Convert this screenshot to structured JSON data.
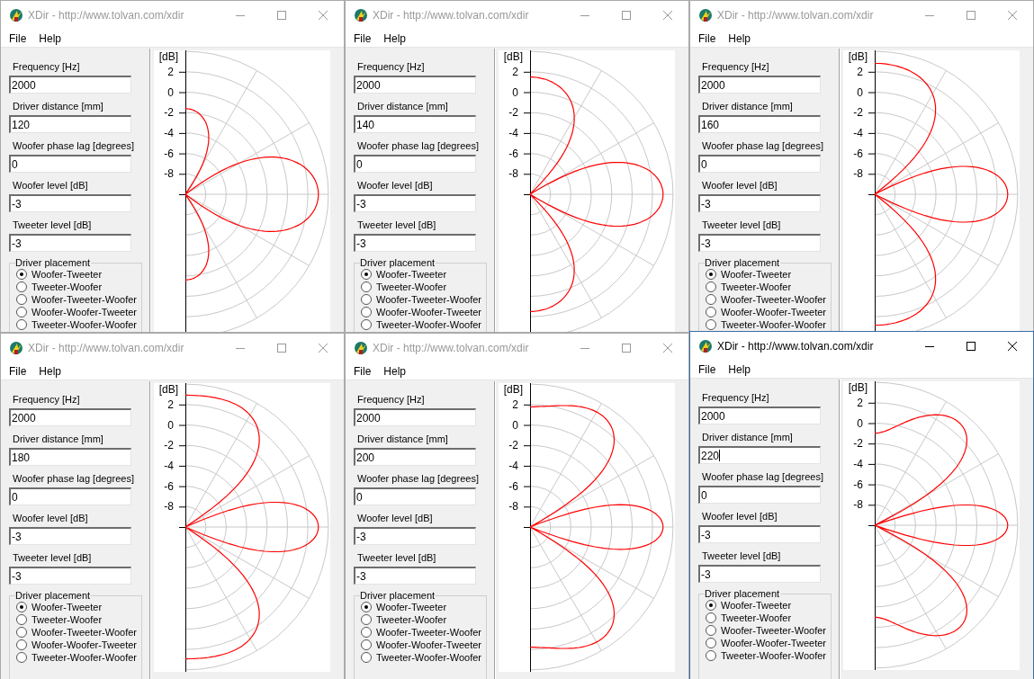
{
  "windows": [
    {
      "title": "XDir - http://www.tolvan.com/xdir",
      "active": false,
      "menu": [
        "File",
        "Help"
      ],
      "fields": [
        {
          "label": "Frequency [Hz]",
          "value": "2000",
          "focused": false
        },
        {
          "label": "Driver distance [mm]",
          "value": "120",
          "focused": false
        },
        {
          "label": "Woofer phase lag [degrees]",
          "value": "0",
          "focused": false
        },
        {
          "label": "Woofer level [dB]",
          "value": "-3",
          "focused": false
        },
        {
          "label": "Tweeter level [dB]",
          "value": "-3",
          "focused": false
        }
      ],
      "placement": {
        "title": "Driver placement",
        "options": [
          {
            "label": "Woofer-Tweeter",
            "selected": true
          },
          {
            "label": "Tweeter-Woofer",
            "selected": false
          },
          {
            "label": "Woofer-Tweeter-Woofer",
            "selected": false
          },
          {
            "label": "Woofer-Woofer-Tweeter",
            "selected": false
          },
          {
            "label": "Tweeter-Woofer-Woofer",
            "selected": false
          }
        ]
      },
      "plot": {
        "unit": "[dB]",
        "ticks": [
          "2",
          "0",
          "-2",
          "-4",
          "-6",
          "-8"
        ]
      }
    },
    {
      "title": "XDir - http://www.tolvan.com/xdir",
      "active": false,
      "menu": [
        "File",
        "Help"
      ],
      "fields": [
        {
          "label": "Frequency [Hz]",
          "value": "2000",
          "focused": false
        },
        {
          "label": "Driver distance [mm]",
          "value": "140",
          "focused": false
        },
        {
          "label": "Woofer phase lag [degrees]",
          "value": "0",
          "focused": false
        },
        {
          "label": "Woofer level [dB]",
          "value": "-3",
          "focused": false
        },
        {
          "label": "Tweeter level [dB]",
          "value": "-3",
          "focused": false
        }
      ],
      "placement": {
        "title": "Driver placement",
        "options": [
          {
            "label": "Woofer-Tweeter",
            "selected": true
          },
          {
            "label": "Tweeter-Woofer",
            "selected": false
          },
          {
            "label": "Woofer-Tweeter-Woofer",
            "selected": false
          },
          {
            "label": "Woofer-Woofer-Tweeter",
            "selected": false
          },
          {
            "label": "Tweeter-Woofer-Woofer",
            "selected": false
          }
        ]
      },
      "plot": {
        "unit": "[dB]",
        "ticks": [
          "2",
          "0",
          "-2",
          "-4",
          "-6",
          "-8"
        ]
      }
    },
    {
      "title": "XDir - http://www.tolvan.com/xdir",
      "active": false,
      "menu": [
        "File",
        "Help"
      ],
      "fields": [
        {
          "label": "Frequency [Hz]",
          "value": "2000",
          "focused": false
        },
        {
          "label": "Driver distance [mm]",
          "value": "160",
          "focused": false
        },
        {
          "label": "Woofer phase lag [degrees]",
          "value": "0",
          "focused": false
        },
        {
          "label": "Woofer level [dB]",
          "value": "-3",
          "focused": false
        },
        {
          "label": "Tweeter level [dB]",
          "value": "-3",
          "focused": false
        }
      ],
      "placement": {
        "title": "Driver placement",
        "options": [
          {
            "label": "Woofer-Tweeter",
            "selected": true
          },
          {
            "label": "Tweeter-Woofer",
            "selected": false
          },
          {
            "label": "Woofer-Tweeter-Woofer",
            "selected": false
          },
          {
            "label": "Woofer-Woofer-Tweeter",
            "selected": false
          },
          {
            "label": "Tweeter-Woofer-Woofer",
            "selected": false
          }
        ]
      },
      "plot": {
        "unit": "[dB]",
        "ticks": [
          "2",
          "0",
          "-2",
          "-4",
          "-6",
          "-8"
        ]
      }
    },
    {
      "title": "XDir - http://www.tolvan.com/xdir",
      "active": false,
      "menu": [
        "File",
        "Help"
      ],
      "fields": [
        {
          "label": "Frequency [Hz]",
          "value": "2000",
          "focused": false
        },
        {
          "label": "Driver distance [mm]",
          "value": "180",
          "focused": false
        },
        {
          "label": "Woofer phase lag [degrees]",
          "value": "0",
          "focused": false
        },
        {
          "label": "Woofer level [dB]",
          "value": "-3",
          "focused": false
        },
        {
          "label": "Tweeter level [dB]",
          "value": "-3",
          "focused": false
        }
      ],
      "placement": {
        "title": "Driver placement",
        "options": [
          {
            "label": "Woofer-Tweeter",
            "selected": true
          },
          {
            "label": "Tweeter-Woofer",
            "selected": false
          },
          {
            "label": "Woofer-Tweeter-Woofer",
            "selected": false
          },
          {
            "label": "Woofer-Woofer-Tweeter",
            "selected": false
          },
          {
            "label": "Tweeter-Woofer-Woofer",
            "selected": false
          }
        ]
      },
      "plot": {
        "unit": "[dB]",
        "ticks": [
          "2",
          "0",
          "-2",
          "-4",
          "-6",
          "-8"
        ]
      }
    },
    {
      "title": "XDir - http://www.tolvan.com/xdir",
      "active": false,
      "menu": [
        "File",
        "Help"
      ],
      "fields": [
        {
          "label": "Frequency [Hz]",
          "value": "2000",
          "focused": false
        },
        {
          "label": "Driver distance [mm]",
          "value": "200",
          "focused": false
        },
        {
          "label": "Woofer phase lag [degrees]",
          "value": "0",
          "focused": false
        },
        {
          "label": "Woofer level [dB]",
          "value": "-3",
          "focused": false
        },
        {
          "label": "Tweeter level [dB]",
          "value": "-3",
          "focused": false
        }
      ],
      "placement": {
        "title": "Driver placement",
        "options": [
          {
            "label": "Woofer-Tweeter",
            "selected": true
          },
          {
            "label": "Tweeter-Woofer",
            "selected": false
          },
          {
            "label": "Woofer-Tweeter-Woofer",
            "selected": false
          },
          {
            "label": "Woofer-Woofer-Tweeter",
            "selected": false
          },
          {
            "label": "Tweeter-Woofer-Woofer",
            "selected": false
          }
        ]
      },
      "plot": {
        "unit": "[dB]",
        "ticks": [
          "2",
          "0",
          "-2",
          "-4",
          "-6",
          "-8"
        ]
      }
    },
    {
      "title": "XDir - http://www.tolvan.com/xdir",
      "active": true,
      "menu": [
        "File",
        "Help"
      ],
      "fields": [
        {
          "label": "Frequency [Hz]",
          "value": "2000",
          "focused": false
        },
        {
          "label": "Driver distance [mm]",
          "value": "220",
          "focused": true
        },
        {
          "label": "Woofer phase lag [degrees]",
          "value": "0",
          "focused": false
        },
        {
          "label": "Woofer level [dB]",
          "value": "-3",
          "focused": false
        },
        {
          "label": "Tweeter level [dB]",
          "value": "-3",
          "focused": false
        }
      ],
      "placement": {
        "title": "Driver placement",
        "options": [
          {
            "label": "Woofer-Tweeter",
            "selected": true
          },
          {
            "label": "Tweeter-Woofer",
            "selected": false
          },
          {
            "label": "Woofer-Tweeter-Woofer",
            "selected": false
          },
          {
            "label": "Woofer-Woofer-Tweeter",
            "selected": false
          },
          {
            "label": "Tweeter-Woofer-Woofer",
            "selected": false
          }
        ]
      },
      "plot": {
        "unit": "[dB]",
        "ticks": [
          "2",
          "0",
          "-2",
          "-4",
          "-6",
          "-8"
        ]
      }
    }
  ]
}
